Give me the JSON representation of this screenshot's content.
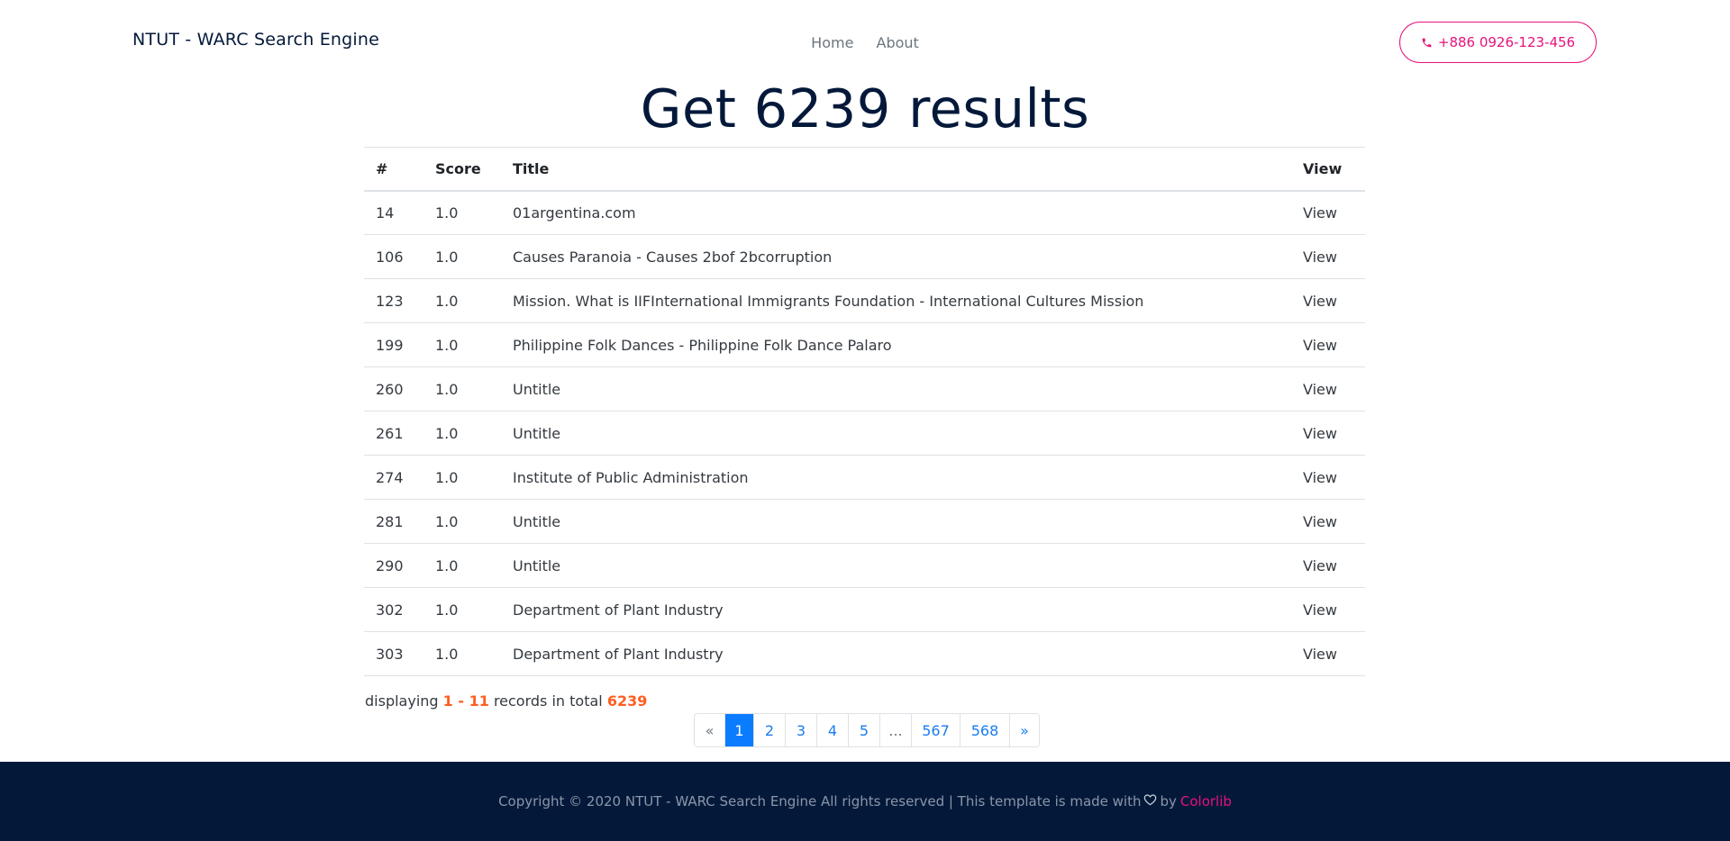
{
  "header": {
    "brand": "NTUT - WARC Search Engine",
    "nav": [
      {
        "label": "Home"
      },
      {
        "label": "About"
      }
    ],
    "phone_button": {
      "label": "+886 0926-123-456",
      "icon": "phone-icon"
    }
  },
  "main": {
    "title": "Get 6239 results",
    "table": {
      "columns": [
        "#",
        "Score",
        "Title",
        "View"
      ],
      "rows": [
        {
          "id": "14",
          "score": "1.0",
          "title": "01argentina.com",
          "view": "View"
        },
        {
          "id": "106",
          "score": "1.0",
          "title": "Causes Paranoia - Causes 2bof 2bcorruption",
          "view": "View"
        },
        {
          "id": "123",
          "score": "1.0",
          "title": "Mission. What is IIFInternational Immigrants Foundation - International Cultures Mission",
          "view": "View"
        },
        {
          "id": "199",
          "score": "1.0",
          "title": "Philippine Folk Dances - Philippine Folk Dance Palaro",
          "view": "View"
        },
        {
          "id": "260",
          "score": "1.0",
          "title": "Untitle",
          "view": "View"
        },
        {
          "id": "261",
          "score": "1.0",
          "title": "Untitle",
          "view": "View"
        },
        {
          "id": "274",
          "score": "1.0",
          "title": "Institute of Public Administration",
          "view": "View"
        },
        {
          "id": "281",
          "score": "1.0",
          "title": "Untitle",
          "view": "View"
        },
        {
          "id": "290",
          "score": "1.0",
          "title": "Untitle",
          "view": "View"
        },
        {
          "id": "302",
          "score": "1.0",
          "title": "Department of Plant Industry",
          "view": "View"
        },
        {
          "id": "303",
          "score": "1.0",
          "title": "Department of Plant Industry",
          "view": "View"
        }
      ]
    },
    "summary": {
      "prefix": "displaying",
      "range": "1 - 11",
      "middle": "records in total",
      "total": "6239"
    },
    "pagination": {
      "prev": "«",
      "pages": [
        "1",
        "2",
        "3",
        "4",
        "5",
        "...",
        "567",
        "568"
      ],
      "active": "1",
      "next": "»"
    }
  },
  "footer": {
    "text_before": "Copyright © 2020 NTUT - WARC Search Engine All rights reserved | This template is made with",
    "heart_icon": "heart-icon",
    "by": "by",
    "link": "Colorlib"
  },
  "colors": {
    "brand_navy": "#04193a",
    "accent_pink": "#e6127d",
    "highlight_orange": "#ff5e1f",
    "pagination_active": "#0a7cff"
  }
}
